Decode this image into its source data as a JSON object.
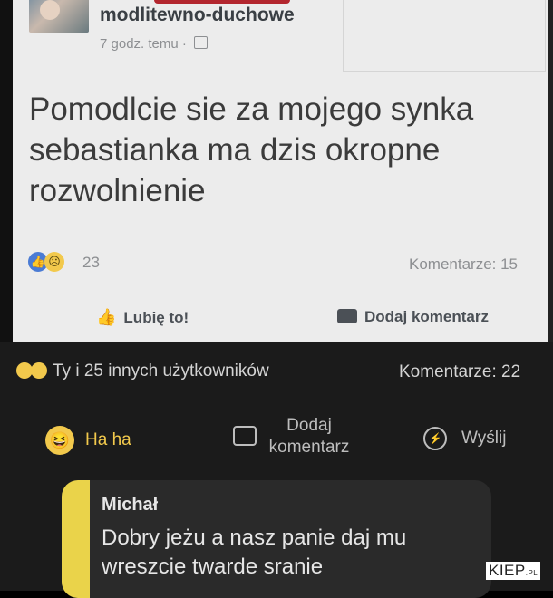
{
  "post": {
    "author": "modlitewno-duchowe",
    "time": "7 godz. temu ·",
    "text": "Pomodlcie sie za mojego synka sebastianka ma dzis okropne rozwolnienie",
    "reaction_count": "23",
    "comments": "Komentarze: 15",
    "like_label": "Lubię to!",
    "comment_label": "Dodaj komentarz",
    "icons": [
      "like-reaction-icon",
      "sad-reaction-icon",
      "globe-icon",
      "thumbs-up-icon",
      "comment-bubble-icon"
    ]
  },
  "dark": {
    "reactions_text": "Ty i 25 innych użytkowników",
    "comments": "Komentarze: 22",
    "haha_label": "Ha ha",
    "comment_label": "Dodaj komentarz",
    "send_label": "Wyślij",
    "comment": {
      "author": "Michał",
      "text": "Dobry jeżu a nasz panie daj mu wreszcie twarde sranie"
    }
  },
  "watermark": {
    "main": "KIEP",
    "suffix": ".PL"
  },
  "colors": {
    "light_bg": "#ececec",
    "dark_bg": "#1b1b1b",
    "haha_yellow": "#f2c94c",
    "accent_bar": "#ead34a"
  }
}
